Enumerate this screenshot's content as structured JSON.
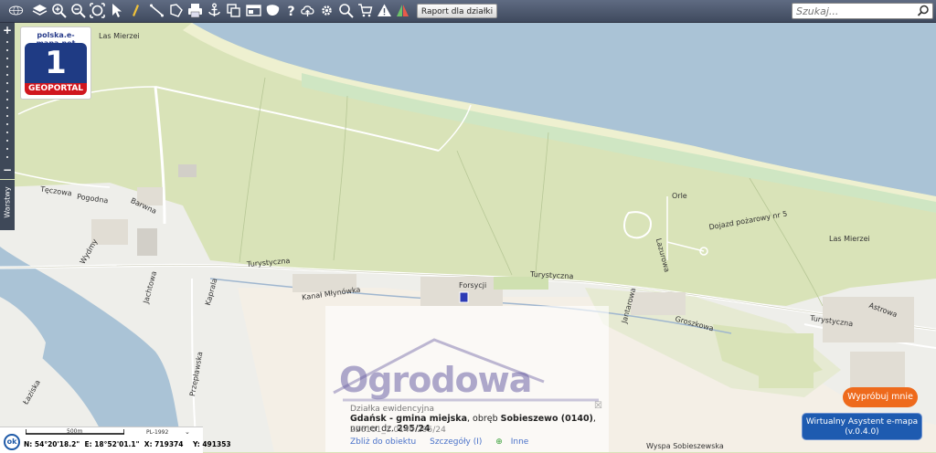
{
  "toolbar": {
    "tools": [
      {
        "name": "globe-icon"
      },
      {
        "name": "layers-icon"
      },
      {
        "name": "zoom-in-icon"
      },
      {
        "name": "zoom-out-icon"
      },
      {
        "name": "full-extent-icon"
      },
      {
        "name": "pointer-icon"
      },
      {
        "name": "info-icon"
      },
      {
        "name": "measure-distance-icon"
      },
      {
        "name": "measure-area-icon"
      },
      {
        "name": "print-icon"
      },
      {
        "name": "anchor-icon"
      },
      {
        "name": "copy-icon"
      },
      {
        "name": "window-layout-icon"
      },
      {
        "name": "shape-icon"
      },
      {
        "name": "help-icon"
      },
      {
        "name": "cloud-upload-icon"
      },
      {
        "name": "settings-icon"
      },
      {
        "name": "search-zoom-icon"
      },
      {
        "name": "cart-icon"
      },
      {
        "name": "warning-icon"
      },
      {
        "name": "split-view-icon"
      }
    ],
    "report_button_label": "Raport dla działki"
  },
  "search": {
    "placeholder": "Szukaj..."
  },
  "sidebar": {
    "layers_tab_label": "Warstwy"
  },
  "logo": {
    "url": "polska.e-mapa.net",
    "number": "1",
    "brand": "GEOPORTAL"
  },
  "map_labels": {
    "las_mierzei_1": "Las Mierzei",
    "las_mierzei_2": "Las Mierzei",
    "teczowa": "Tęczowa",
    "pogodna": "Pogodna",
    "barwna": "Barwna",
    "wydmy": "Wydmy",
    "jachtowa": "Jachtowa",
    "kaprala": "Kaprala",
    "turystyczna_1": "Turystyczna",
    "turystyczna_2": "Turystyczna",
    "turystyczna_3": "Turystyczna",
    "kanal_mlynowka": "Kanał Młynówka",
    "forsycji": "Forsycji",
    "orle": "Orle",
    "dojazd": "Dojazd pożarowy nr 5",
    "lazurowa": "Lazurowa",
    "astrowa": "Astrowa",
    "groszkowa": "Groszkowa",
    "jantarowa": "Jantarowa",
    "przeplawska": "Przepławska",
    "wyspa_sobieszewska": "Wyspa Sobieszewska",
    "laziska": "Łaziska"
  },
  "watermark": {
    "text": "Ogrodowa"
  },
  "popup": {
    "title": "Działka ewidencyjna",
    "line_place": "Gdańsk - gmina miejska",
    "line_precinct_prefix": ", obręb ",
    "line_precinct": "Sobieszewo (0140)",
    "line_number_prefix": ", numer dz. ",
    "line_number": "295/24",
    "parcel_id": "226101_1.0140.295/24",
    "links": {
      "zoom": "Zbliż do obiektu",
      "details": "Szczegóły (I)",
      "other": "Inne"
    }
  },
  "statusbar": {
    "scale_label": "500m",
    "projection": "PL-1992",
    "ok_label": "ok",
    "lat": "N: 54°20'18.2\"",
    "lon": "E: 18°52'01.1\"",
    "x": "X: 719374",
    "y": "Y: 491353"
  },
  "promo": {
    "try_label": "Wypróbuj mnie"
  },
  "assistant": {
    "line1": "Wirtualny Asystent e-mapa",
    "line2": "(v.0.4.0)"
  },
  "colors": {
    "toolbar": "#4a5568",
    "forest": "#d9e3b8",
    "water": "#aac3d6",
    "beach": "#eef0d0",
    "urban": "#eeeeea",
    "road": "#ffffff",
    "accent_orange": "#ee6a1c",
    "accent_blue": "#1e5bb0"
  }
}
